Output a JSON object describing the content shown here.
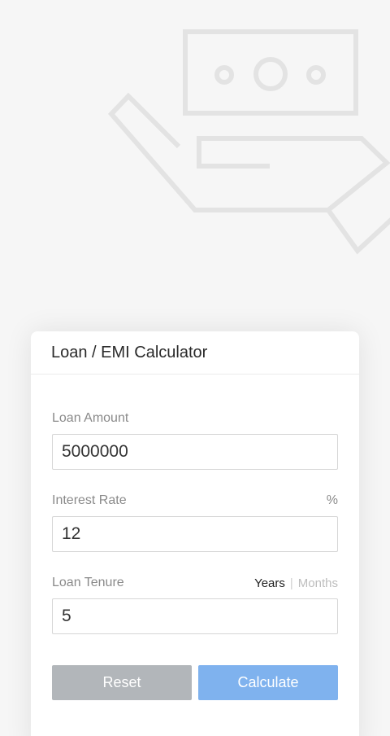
{
  "colors": {
    "page_background": "#f6f6f6",
    "illustration_stroke": "#e3e3e3",
    "reset_button": "#b2b6ba",
    "calculate_button": "#7fb2ee"
  },
  "hero": {
    "icon": "hand-holding-money-icon"
  },
  "calculator": {
    "title": "Loan / EMI Calculator",
    "loan_amount": {
      "label": "Loan Amount",
      "value": "5000000"
    },
    "interest_rate": {
      "label": "Interest Rate",
      "unit": "%",
      "value": "12"
    },
    "loan_tenure": {
      "label": "Loan Tenure",
      "unit_options": [
        "Years",
        "Months"
      ],
      "selected_unit": "Years",
      "separator": "|",
      "value": "5"
    },
    "buttons": {
      "reset": "Reset",
      "calculate": "Calculate"
    }
  }
}
